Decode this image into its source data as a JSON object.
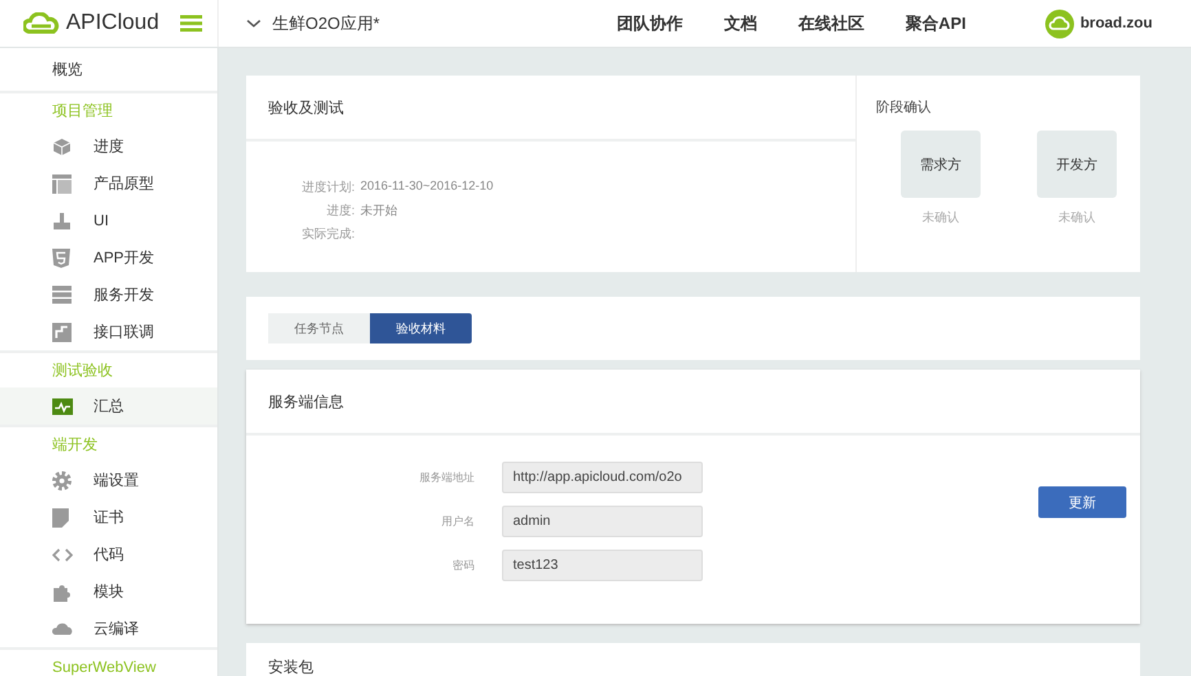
{
  "header": {
    "brand": "APICloud",
    "project": "生鲜O2O应用*",
    "nav": [
      {
        "label": "团队协作"
      },
      {
        "label": "文档"
      },
      {
        "label": "在线社区"
      },
      {
        "label": "聚合API"
      }
    ],
    "user": "broad.zou"
  },
  "sidebar": [
    {
      "kind": "top",
      "label": "概览",
      "selected": false
    },
    {
      "kind": "section",
      "label": "项目管理"
    },
    {
      "kind": "item",
      "label": "进度",
      "selected": false
    },
    {
      "kind": "item",
      "label": "产品原型",
      "selected": false
    },
    {
      "kind": "item",
      "label": "UI",
      "selected": false
    },
    {
      "kind": "item",
      "label": "APP开发",
      "selected": false
    },
    {
      "kind": "item",
      "label": "服务开发",
      "selected": false
    },
    {
      "kind": "item",
      "label": "接口联调",
      "selected": false
    },
    {
      "kind": "section",
      "label": "测试验收"
    },
    {
      "kind": "item",
      "label": "汇总",
      "selected": true
    },
    {
      "kind": "section",
      "label": "端开发"
    },
    {
      "kind": "item",
      "label": "端设置",
      "selected": false
    },
    {
      "kind": "item",
      "label": "证书",
      "selected": false
    },
    {
      "kind": "item",
      "label": "代码",
      "selected": false
    },
    {
      "kind": "item",
      "label": "模块",
      "selected": false
    },
    {
      "kind": "item",
      "label": "云编译",
      "selected": false
    },
    {
      "kind": "section",
      "label": "SuperWebView"
    }
  ],
  "acceptance": {
    "title": "验收及测试",
    "details": [
      {
        "label": "进度计划:",
        "value": "2016-11-30~2016-12-10"
      },
      {
        "label": "进度:",
        "value": "未开始"
      },
      {
        "label": "实际完成:"
      }
    ]
  },
  "stage": {
    "title": "阶段确认",
    "parties": [
      {
        "name": "需求方",
        "status": "未确认"
      },
      {
        "name": "开发方",
        "status": "未确认"
      }
    ]
  },
  "tabs": [
    {
      "label": "任务节点",
      "selected": false
    },
    {
      "label": "验收材料",
      "selected": true
    }
  ],
  "server": {
    "title": "服务端信息",
    "fields": [
      {
        "label": "服务端地址",
        "value": "http://app.apicloud.com/o2o"
      },
      {
        "label": "用户名",
        "value": "admin"
      },
      {
        "label": "密码",
        "value": "test123"
      }
    ],
    "button": "更新"
  },
  "package": {
    "title": "安装包"
  }
}
